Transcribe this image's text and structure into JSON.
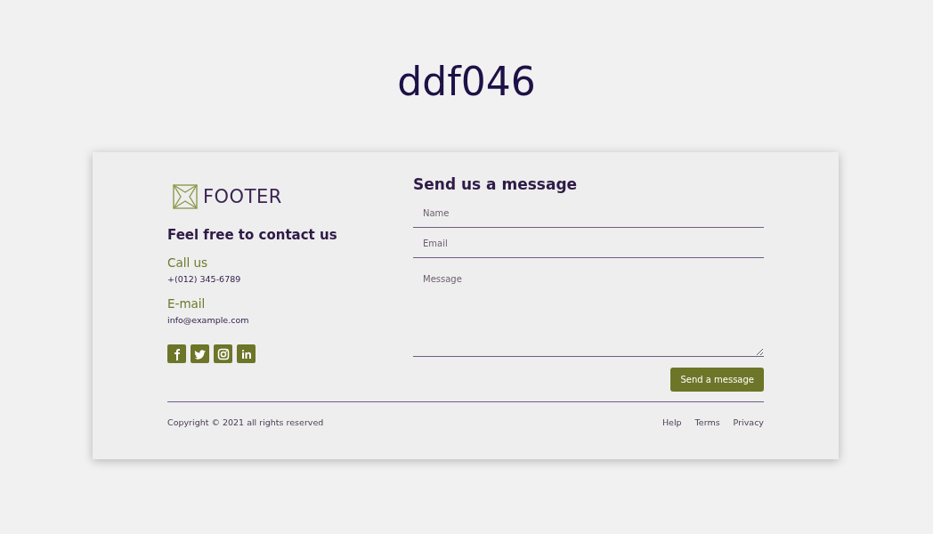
{
  "page_title": "ddf046",
  "footer": {
    "logo_text": "FOOTER",
    "tagline": "Feel free to contact us",
    "contacts": [
      {
        "label": "Call us",
        "value": "+(012) 345-6789"
      },
      {
        "label": "E-mail",
        "value": "info@example.com"
      }
    ],
    "social": [
      {
        "kind": "facebook"
      },
      {
        "kind": "twitter"
      },
      {
        "kind": "instagram"
      },
      {
        "kind": "linkedin"
      }
    ],
    "form": {
      "title": "Send us a message",
      "fields": [
        {
          "kind": "input",
          "placeholder": "Name"
        },
        {
          "kind": "input",
          "placeholder": "Email"
        },
        {
          "kind": "textarea",
          "placeholder": "Message"
        }
      ],
      "button": "Send a message"
    },
    "copyright": "Copyright © 2021 all rights reserved",
    "links": [
      "Help",
      "Terms",
      "Privacy"
    ]
  }
}
